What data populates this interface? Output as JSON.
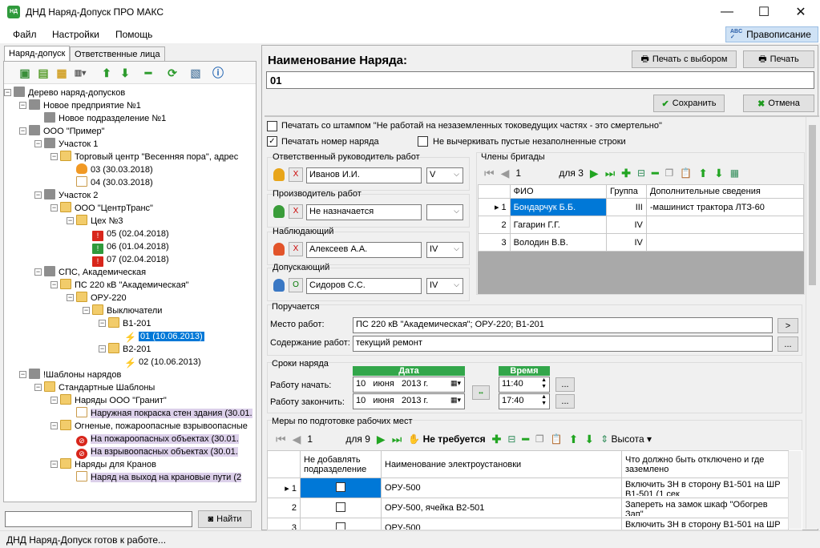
{
  "window": {
    "title": "ДНД Наряд-Допуск ПРО МАКС",
    "icon_text": "НД"
  },
  "menu": {
    "items": [
      "Файл",
      "Настройки",
      "Помощь"
    ],
    "spellcheck": "Правописание"
  },
  "left": {
    "tabs": [
      "Наряд-допуск",
      "Ответственные лица"
    ],
    "tree": [
      {
        "label": "Дерево наряд-допусков",
        "icon": "computer-icon"
      },
      {
        "label": "Новое предприятие №1",
        "icon": "building-icon"
      },
      {
        "label": "Новое подразделение №1",
        "icon": "building-icon"
      },
      {
        "label": "ООО \"Пример\"",
        "icon": "building-icon"
      },
      {
        "label": "Участок 1",
        "icon": "building-icon"
      },
      {
        "label": "Торговый центр \"Весенняя пора\", адрес",
        "icon": "folder-icon"
      },
      {
        "label": "03 (30.03.2018)",
        "icon": "flame-icon"
      },
      {
        "label": "04 (30.03.2018)",
        "icon": "document-icon"
      },
      {
        "label": "Участок 2",
        "icon": "building-icon"
      },
      {
        "label": "ООО \"ЦентрТранс\"",
        "icon": "folder-icon"
      },
      {
        "label": "Цех №3",
        "icon": "folder-icon"
      },
      {
        "label": "05 (02.04.2018)",
        "icon": "warning-red-icon"
      },
      {
        "label": "06 (01.04.2018)",
        "icon": "warning-green-icon"
      },
      {
        "label": "07 (02.04.2018)",
        "icon": "warning-red-icon"
      },
      {
        "label": "СПС, Академическая",
        "icon": "building-icon"
      },
      {
        "label": "ПС 220 кВ \"Академическая\"",
        "icon": "folder-icon"
      },
      {
        "label": "ОРУ-220",
        "icon": "folder-icon"
      },
      {
        "label": "Выключатели",
        "icon": "folder-icon"
      },
      {
        "label": "В1-201",
        "icon": "folder-icon"
      },
      {
        "label": "01 (10.06.2013)",
        "icon": "bolt-icon"
      },
      {
        "label": "В2-201",
        "icon": "folder-icon"
      },
      {
        "label": "02 (10.06.2013)",
        "icon": "bolt-icon"
      },
      {
        "label": "!Шаблоны нарядов",
        "icon": "building-icon"
      },
      {
        "label": "Стандартные Шаблоны",
        "icon": "folder-icon"
      },
      {
        "label": "Наряды ООО \"Гранит\"",
        "icon": "folder-icon"
      },
      {
        "label": "Наружная покраска стен здания (30.01.",
        "icon": "document-icon"
      },
      {
        "label": "Огненые, пожароопасные взрывоопасные",
        "icon": "folder-icon"
      },
      {
        "label": "На пожароопасных объектах (30.01.",
        "icon": "no-fire-icon"
      },
      {
        "label": "На взрывоопасных объектах (30.01.",
        "icon": "no-fire-icon"
      },
      {
        "label": "Наряды для Кранов",
        "icon": "folder-icon"
      },
      {
        "label": "Наряд на выход на крановые пути (2",
        "icon": "crane-icon"
      }
    ],
    "search_button": "Найти"
  },
  "right": {
    "name_label": "Наименование Наряда:",
    "name_value": "01",
    "print_select": "Печать с выбором",
    "print": "Печать",
    "save": "Сохранить",
    "cancel": "Отмена",
    "stamp_check": "Печатать со штампом \"Не работай на незаземленных токоведущих частях - это смертельно\"",
    "print_number": "Печатать номер наряда",
    "no_strike": "Не вычеркивать пустые незаполненные строки",
    "roles": [
      {
        "label": "Ответственный руководитель работ",
        "name": "Иванов И.И.",
        "group": "V",
        "mark": "X"
      },
      {
        "label": "Производитель работ",
        "name": "Не назначается",
        "group": "",
        "mark": "X"
      },
      {
        "label": "Наблюдающий",
        "name": "Алексеев А.А.",
        "group": "IV",
        "mark": "X"
      },
      {
        "label": "Допускающий",
        "name": "Сидоров С.С.",
        "group": "IV",
        "mark": "O"
      }
    ],
    "crew": {
      "title": "Члены бригады",
      "position": "1",
      "of": "для 3",
      "columns": [
        "ФИО",
        "Группа",
        "Дополнительные сведения"
      ],
      "rows": [
        {
          "n": "1",
          "fio": "Бондарчук Б.Б.",
          "group": "III",
          "info": "-машинист трактора ЛТЗ-60"
        },
        {
          "n": "2",
          "fio": "Гагарин Г.Г.",
          "group": "IV",
          "info": ""
        },
        {
          "n": "3",
          "fio": "Володин В.В.",
          "group": "IV",
          "info": ""
        }
      ]
    },
    "assigned": {
      "title": "Поручается",
      "place_label": "Место работ:",
      "place_value": "ПС 220 кВ \"Академическая\"; ОРУ-220; В1-201",
      "content_label": "Содержание работ:",
      "content_value": "текущий ремонт",
      "btn_arrow": ">",
      "btn_more": "..."
    },
    "terms": {
      "title": "Сроки наряда",
      "date_header": "Дата",
      "time_header": "Время",
      "start_label": "Работу начать:",
      "end_label": "Работу закончить:",
      "start_date": "10   июня   2013 г.",
      "end_date": "10   июня   2013 г.",
      "start_time": "11:40",
      "end_time": "17:40",
      "swap": "••",
      "more": "..."
    },
    "measures": {
      "title": "Меры по подготовке рабочих мест",
      "position": "1",
      "of": "для 9",
      "not_required": "Не требуется",
      "height": "Высота",
      "columns": [
        "Не добавлять подразделение",
        "Наименование электроустановки",
        "Что должно быть отключено и где заземлено"
      ],
      "rows": [
        {
          "n": "1",
          "name": "ОРУ-500",
          "what": "Включить ЗН в сторону В1-501 на ШР В1-501 (1 сек"
        },
        {
          "n": "2",
          "name": "ОРУ-500, ячейка В2-501",
          "what": "Запереть на замок шкаф \"Обогрев Зап\""
        },
        {
          "n": "3",
          "name": "ОРУ-500",
          "what": "Включить ЗН в сторону В1-501 на ШР В1-501 (2 сек"
        }
      ]
    }
  },
  "status": "ДНД Наряд-Допуск готов к работе..."
}
